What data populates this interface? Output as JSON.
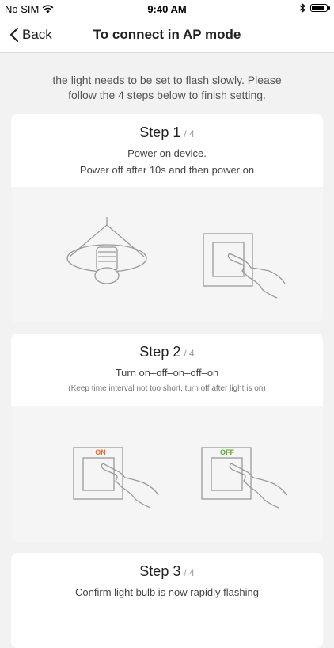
{
  "status_bar": {
    "carrier": "No SIM",
    "time": "9:40 AM"
  },
  "nav": {
    "back_label": "Back",
    "title": "To connect in AP mode"
  },
  "intro": {
    "line1": "the light needs to be set to flash slowly. Please",
    "line2": "follow the 4 steps below to finish setting."
  },
  "steps": [
    {
      "label": "Step 1",
      "total": "/ 4",
      "line1": "Power on device.",
      "line2": "Power off after 10s and then power on"
    },
    {
      "label": "Step 2",
      "total": "/ 4",
      "line1": "Turn on–off–on–off–on",
      "line2": "(Keep time interval not too short, turn off after light is on)",
      "switch_on_label": "ON",
      "switch_off_label": "OFF"
    },
    {
      "label": "Step 3",
      "total": "/ 4",
      "line1": "Confirm light bulb is now rapidly flashing"
    }
  ],
  "colors": {
    "on_label": "#e8692a",
    "off_label": "#5aa832",
    "line_art": "#9a9a9a"
  }
}
